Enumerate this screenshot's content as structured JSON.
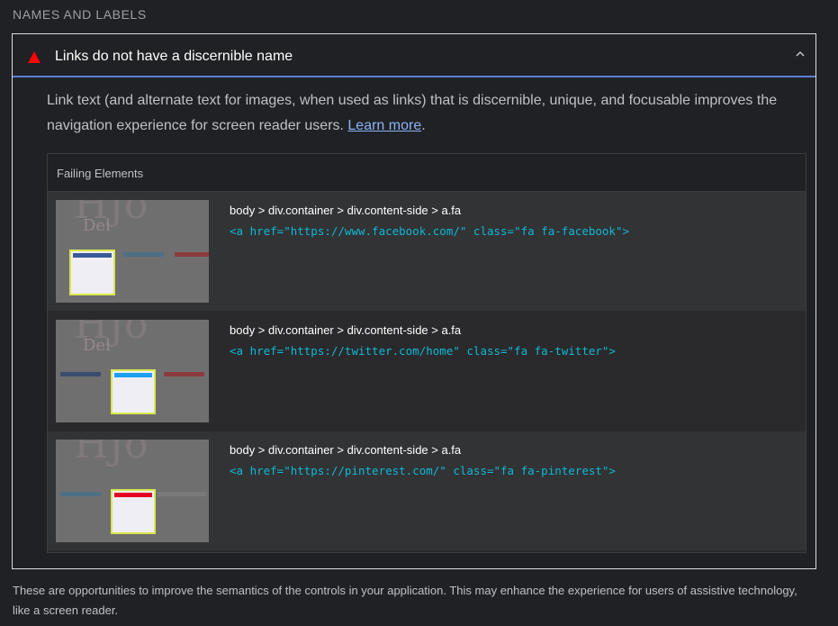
{
  "section": {
    "title": "NAMES AND LABELS"
  },
  "audit": {
    "status_icon": "fail-triangle-icon",
    "status_color": "#ff0000",
    "title": "Links do not have a discernible name",
    "expand_icon": "chevron-up-icon",
    "description_text": "Link text (and alternate text for images, when used as links) that is discernible, unique, and focusable improves the navigation experience for screen reader users. ",
    "learn_more": "Learn more",
    "description_end": "."
  },
  "failing": {
    "header": "Failing Elements",
    "items": [
      {
        "selector": "body > div.container > div.content-side > a.fa",
        "snippet": "<a href=\"https://www.facebook.com/\" class=\"fa fa-facebook\">",
        "highlight_color": "#3b5998"
      },
      {
        "selector": "body > div.container > div.content-side > a.fa",
        "snippet": "<a href=\"https://twitter.com/home\" class=\"fa fa-twitter\">",
        "highlight_color": "#1da1f2"
      },
      {
        "selector": "body > div.container > div.content-side > a.fa",
        "snippet": "<a href=\"https://pinterest.com/\" class=\"fa fa-pinterest\">",
        "highlight_color": "#e60023"
      }
    ]
  },
  "footer": {
    "text": "These are opportunities to improve the semantics of the controls in your application. This may enhance the experience for users of assistive technology, like a screen reader."
  },
  "colors": {
    "accent_border": "#5a7fd1",
    "link": "#8ab4f8",
    "code": "#0fb9d6",
    "highlight_box": "#d7e84c"
  }
}
